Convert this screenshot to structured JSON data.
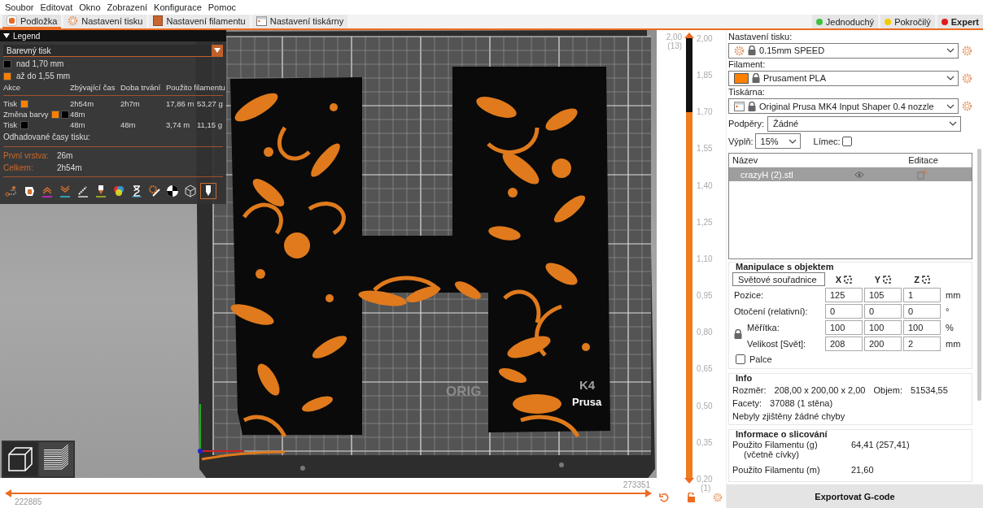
{
  "menu": [
    "Soubor",
    "Editovat",
    "Okno",
    "Zobrazení",
    "Konfigurace",
    "Pomoc"
  ],
  "tabs": [
    {
      "label": "Podložka",
      "kind": "plater",
      "selected": true
    },
    {
      "label": "Nastavení tisku",
      "kind": "print",
      "selected": false
    },
    {
      "label": "Nastavení filamentu",
      "kind": "filament",
      "selected": false
    },
    {
      "label": "Nastavení tiskárny",
      "kind": "printer",
      "selected": false
    }
  ],
  "modes": [
    {
      "label": "Jednoduchý",
      "color": "#3fbf3f",
      "selected": false
    },
    {
      "label": "Pokročilý",
      "color": "#f2cc00",
      "selected": false
    },
    {
      "label": "Expert",
      "color": "#e01b1b",
      "selected": true
    }
  ],
  "legend": {
    "title": "Legend",
    "expanded": true,
    "view_type": "Barevný tisk",
    "color_ranges": [
      {
        "label": "nad 1,70 mm",
        "color": "#000000"
      },
      {
        "label": "až do 1,55 mm",
        "color": "#ff8000"
      }
    ],
    "columns": [
      "Akce",
      "Zbývající čas",
      "Doba trvání",
      "Použito filamentu"
    ],
    "rows": [
      {
        "action": "Tisk",
        "swatches": [
          {
            "color": "#ff8000"
          }
        ],
        "remaining": "2h54m",
        "duration": "2h7m",
        "length": "17,86 m",
        "weight": "53,27 g"
      },
      {
        "action": "Změna barvy",
        "swatches": [
          {
            "color": "#ff8000"
          },
          {
            "color": "#000000"
          }
        ],
        "remaining": "48m"
      },
      {
        "action": "Tisk",
        "swatches": [
          {
            "color": "#000000"
          }
        ],
        "remaining": "48m",
        "duration": "48m",
        "length": "3,74 m",
        "weight": "11,15 g"
      }
    ],
    "estimates_title": "Odhadované časy tisku:",
    "estimates": [
      {
        "label": "První vrstva:",
        "value": "26m"
      },
      {
        "label": "Celkem:",
        "value": "2h54m"
      }
    ],
    "toolbar": [
      {
        "kind": "travel",
        "selected": false
      },
      {
        "kind": "wipe",
        "selected": false
      },
      {
        "kind": "retractions",
        "selected": false
      },
      {
        "kind": "deretractions",
        "selected": false
      },
      {
        "kind": "seams",
        "selected": false
      },
      {
        "kind": "tool-changes",
        "selected": false
      },
      {
        "kind": "color-changes",
        "selected": false
      },
      {
        "kind": "pauses",
        "selected": false
      },
      {
        "kind": "custom-gcode",
        "selected": false
      },
      {
        "kind": "center-of-gravity",
        "selected": false
      },
      {
        "kind": "shells",
        "selected": false
      },
      {
        "kind": "tool-marker",
        "selected": true
      }
    ]
  },
  "view_modes": [
    {
      "kind": "solid",
      "selected": false
    },
    {
      "kind": "preview",
      "selected": true
    }
  ],
  "bed_labels": [
    "ORIG",
    "K4",
    "Prusa"
  ],
  "v_slider": {
    "top_value": "2,00",
    "top_layer": "(13)",
    "bottom_layer": "(1)",
    "ticks": [
      "2,00",
      "1,85",
      "1,70",
      "1,55",
      "1,40",
      "1,25",
      "1,10",
      "0,95",
      "0,80",
      "0,65",
      "0,50",
      "0,35",
      "0,20"
    ],
    "upper_band": {
      "color": "#111111"
    },
    "lower_band": {
      "color": "#f07c1a",
      "level": 0.83
    },
    "upper_thumb": {
      "level": 1
    },
    "lower_thumb": {
      "level": 0
    }
  },
  "h_slider": {
    "start_label": "222885",
    "end_label": "273351",
    "lower_thumb": {
      "level": 0
    },
    "upper_thumb": {
      "level": 1
    }
  },
  "presets": [
    {
      "label": "Nastavení tisku:",
      "value": "0.15mm SPEED",
      "kind": "print"
    },
    {
      "label": "Filament:",
      "value": "Prusament PLA",
      "kind": "filament",
      "color": "#ff8000"
    },
    {
      "label": "Tiskárna:",
      "value": "Original Prusa MK4 Input Shaper 0.4 nozzle",
      "kind": "printer"
    }
  ],
  "supports": {
    "label": "Podpěry:",
    "value": "Žádné"
  },
  "infill": {
    "label": "Výplň:",
    "value": "15%"
  },
  "brim": {
    "label": "Límec:",
    "checked": false
  },
  "objects": {
    "columns": [
      "Název",
      "Editace"
    ],
    "rows": [
      {
        "name": "crazyH (2).stl",
        "selected": true,
        "visible": true
      }
    ]
  },
  "manipulation": {
    "title": "Manipulace s objektem",
    "coordinates": "Světové souřadnice",
    "axes": [
      "X",
      "Y",
      "Z"
    ],
    "rows": [
      {
        "label": "Pozice:",
        "values": [
          "125",
          "105",
          "1"
        ],
        "unit": "mm"
      },
      {
        "label": "Otočení (relativní):",
        "values": [
          "0",
          "0",
          "0"
        ],
        "unit": "°"
      },
      {
        "label": "Měřítka:",
        "values": [
          "100",
          "100",
          "100"
        ],
        "unit": "%"
      },
      {
        "label": "Velikost [Svět]:",
        "values": [
          "208",
          "200",
          "2"
        ],
        "unit": "mm"
      }
    ],
    "scale_locked": true,
    "inches": {
      "label": "Palce",
      "checked": false
    }
  },
  "info": {
    "title": "Info",
    "size_label": "Rozměr:",
    "size": "208,00 x 200,00 x 2,00",
    "volume_label": "Objem:",
    "volume": "51534,55",
    "facets_label": "Facety:",
    "facets": "37088 (1 stěna)",
    "status": "Nebyly zjištěny žádné chyby"
  },
  "slicing": {
    "title": "Informace o slicování",
    "rows": [
      {
        "label": "Použito Filamentu (g)",
        "sublabel": "(včetně cívky)",
        "value": "64,41 (257,41)"
      },
      {
        "label": "Použito Filamentu (m)",
        "value": "21,60"
      }
    ]
  },
  "export": "Exportovat G-code"
}
